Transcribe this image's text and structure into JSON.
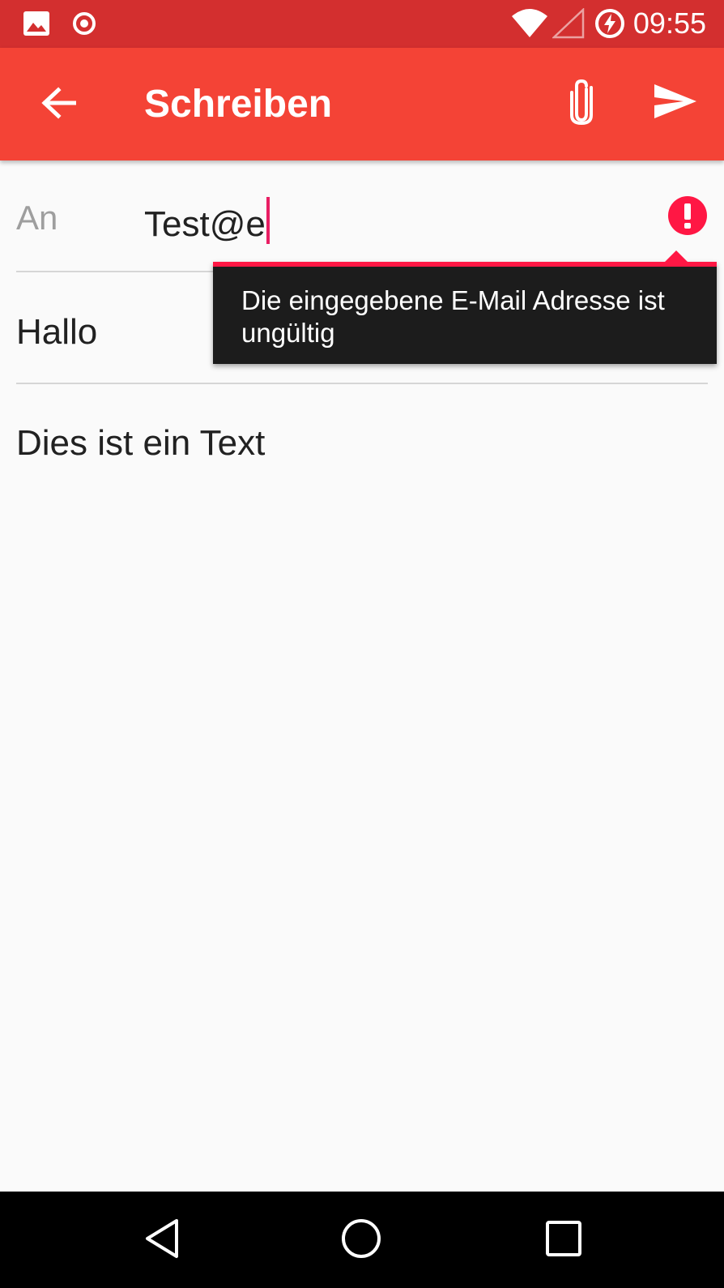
{
  "status_bar": {
    "time": "09:55",
    "icons": [
      "image-icon",
      "record-icon",
      "wifi-icon",
      "signal-icon",
      "battery-charging-icon"
    ],
    "color": "#d32f2f"
  },
  "app_bar": {
    "title": "Schreiben",
    "color": "#f44336",
    "icons": [
      "back-arrow-icon",
      "paperclip-icon",
      "send-icon"
    ]
  },
  "compose": {
    "to_label": "An",
    "to_value": "Test@e",
    "subject_value": "Hallo",
    "body_value": "Dies ist ein Text"
  },
  "error": {
    "message": "Die eingegebene E-Mail Adresse ist ungültig",
    "color": "#ff1744",
    "icon": "error-icon"
  },
  "nav_bar": {
    "icons": [
      "nav-back-icon",
      "nav-home-icon",
      "nav-recents-icon"
    ]
  }
}
